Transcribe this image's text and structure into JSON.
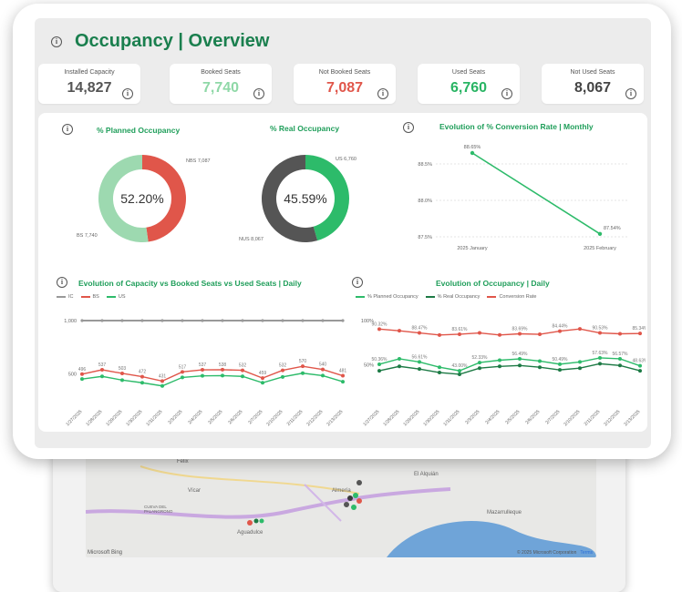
{
  "title": "Occupancy | Overview",
  "kpis": [
    {
      "label": "Installed Capacity",
      "value": "14,827",
      "color": "#555555"
    },
    {
      "label": "Booked Seats",
      "value": "7,740",
      "color": "#8fd8a7"
    },
    {
      "label": "Not Booked Seats",
      "value": "7,087",
      "color": "#e0564a"
    },
    {
      "label": "Used Seats",
      "value": "6,760",
      "color": "#28b463"
    },
    {
      "label": "Not Used Seats",
      "value": "8,067",
      "color": "#444444"
    }
  ],
  "planned": {
    "title": "% Planned Occupancy",
    "center": "52.20%",
    "label_nbs": "NBS 7,087",
    "label_bs": "BS 7,740",
    "booked_fraction": 0.522,
    "colors": {
      "booked": "#9dd9b0",
      "not_booked": "#e0564a"
    }
  },
  "real": {
    "title": "% Real Occupancy",
    "center": "45.59%",
    "label_us": "US 6,760",
    "label_nus": "NUS 8,067",
    "used_fraction": 0.4559,
    "colors": {
      "used": "#2dbb6a",
      "not_used": "#555555"
    }
  },
  "conversion": {
    "title": "Evolution of % Conversion Rate | Monthly",
    "y_ticks": [
      "88.5%",
      "88.0%",
      "87.5%"
    ],
    "x_labels": [
      "2025 January",
      "2025 February"
    ],
    "values": [
      88.65,
      87.54
    ],
    "value_labels": [
      "88.65%",
      "87.54%"
    ],
    "y_range": [
      87.5,
      88.75
    ]
  },
  "capacity": {
    "title": "Evolution of Capacity vs Booked Seats vs Used Seats | Daily",
    "legend": [
      "IC",
      "BS",
      "US"
    ],
    "colors": [
      "#999999",
      "#e0564a",
      "#2dbb6a"
    ],
    "y_ticks": [
      "1,000",
      "500"
    ],
    "dates": [
      "1/27/2025",
      "1/28/2025",
      "1/29/2025",
      "1/30/2025",
      "1/31/2025",
      "2/3/2025",
      "2/4/2025",
      "2/5/2025",
      "2/6/2025",
      "2/7/2025",
      "2/10/2025",
      "2/11/2025",
      "2/12/2025",
      "2/13/2025"
    ],
    "ic": [
      1000,
      1000,
      1000,
      1000,
      1000,
      1000,
      1000,
      1000,
      1000,
      1000,
      1000,
      1000,
      1000,
      1000
    ],
    "bs": [
      496,
      537,
      503,
      472,
      431,
      517,
      537,
      538,
      532,
      459,
      532,
      570,
      540,
      481
    ],
    "us": [
      450,
      475,
      440,
      415,
      385,
      465,
      480,
      482,
      475,
      415,
      470,
      505,
      482,
      425
    ],
    "bs_labels": [
      "496",
      "537",
      "503",
      "472",
      "431",
      "517",
      "537",
      "538",
      "532",
      "459",
      "532",
      "570",
      "540",
      "481"
    ]
  },
  "occupancy": {
    "title": "Evolution of Occupancy | Daily",
    "legend": [
      "% Planned Occupancy",
      "% Real Occupancy",
      "Conversion Rate"
    ],
    "colors": [
      "#2dbb6a",
      "#1d7a45",
      "#e0564a"
    ],
    "y_ticks": [
      "100%",
      "50%"
    ],
    "dates": [
      "1/27/2025",
      "1/28/2025",
      "1/29/2025",
      "1/30/2025",
      "1/31/2025",
      "2/3/2025",
      "2/4/2025",
      "2/5/2025",
      "2/6/2025",
      "2/7/2025",
      "2/10/2025",
      "2/11/2025",
      "2/12/2025",
      "2/13/2025"
    ],
    "conv": [
      90.32,
      88.47,
      86.0,
      83.61,
      84.5,
      86.0,
      83.69,
      85.0,
      84.44,
      88.0,
      90.53,
      86.0,
      85.0,
      85.34
    ],
    "conv_labels": [
      "90.32%",
      "",
      "88.47%",
      "",
      "83.61%",
      "",
      "",
      "83.69%",
      "",
      "84.44%",
      "",
      "90.53%",
      "",
      "85.34%"
    ],
    "planned": [
      50.36,
      56.61,
      53.0,
      47.0,
      43.0,
      52.33,
      55.0,
      56.49,
      54.0,
      50.49,
      53.0,
      57.63,
      56.57,
      48.63
    ],
    "planned_labels": [
      "50.36%",
      "",
      "56.61%",
      "",
      "43.00%",
      "52.33%",
      "",
      "56.49%",
      "",
      "50.49%",
      "",
      "57.63%",
      "56.57%",
      "48.63%"
    ],
    "real": [
      43.0,
      48.0,
      45.0,
      41.0,
      39.0,
      46.0,
      48.0,
      49.0,
      47.0,
      44.0,
      46.0,
      51.0,
      49.0,
      43.0
    ]
  },
  "map": {
    "labels": [
      "Felix",
      "Vícar",
      "CUEVA DEL PALANGRONO",
      "Aguadulce",
      "El Alquián",
      "Almería",
      "Mazarrulleque"
    ],
    "footer_left": "Microsoft Bing",
    "footer_right": "© 2025 Microsoft Corporation",
    "terms": "Terms"
  }
}
